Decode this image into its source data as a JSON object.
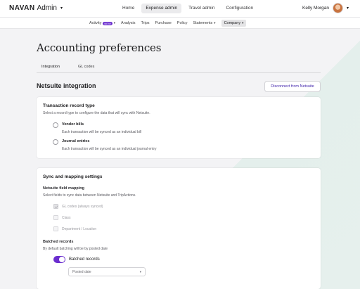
{
  "topbar": {
    "logo_mark": "NAVAN",
    "logo_text": "Admin",
    "nav": [
      {
        "label": "Home",
        "active": false
      },
      {
        "label": "Expense admin",
        "active": true
      },
      {
        "label": "Travel admin",
        "active": false
      },
      {
        "label": "Configuration",
        "active": false
      }
    ],
    "user_name": "Kelly Morgan"
  },
  "subnav": {
    "items": [
      {
        "label": "Activity",
        "badge": "NEW",
        "has_chevron": true
      },
      {
        "label": "Analysis"
      },
      {
        "label": "Trips"
      },
      {
        "label": "Purchase"
      },
      {
        "label": "Policy"
      },
      {
        "label": "Statements",
        "has_chevron": true
      },
      {
        "label": "Company",
        "has_chevron": true,
        "active": true
      }
    ]
  },
  "page": {
    "title": "Accounting preferences",
    "tabs": [
      {
        "label": "Integration",
        "active": true
      },
      {
        "label": "GL codes",
        "active": false
      }
    ],
    "section_title": "Netsuite integration",
    "disconnect_label": "Disconnect from Netsuite"
  },
  "transaction_card": {
    "heading": "Transaction record type",
    "subheading": "Select a record type to configure the data that will sync with Netsuite.",
    "options": [
      {
        "label": "Vendor bills",
        "desc": "Each transaction will be synced as an individual bill"
      },
      {
        "label": "Journal entries",
        "desc": "Each transaction will be synced as an individual journal entry"
      }
    ]
  },
  "sync_card": {
    "heading": "Sync and mapping settings",
    "field_mapping_title": "Netsuite field mapping",
    "field_mapping_sub": "Select fields to sync data between Netsuite and TripActions.",
    "fields": [
      {
        "label": "GL codes (always synced)",
        "checked": true
      },
      {
        "label": "Class",
        "checked": false
      },
      {
        "label": "Department / Location",
        "checked": false
      }
    ],
    "batched_title": "Batched records",
    "batched_sub": "By default batching will be by posted date",
    "toggle_label": "Batched records",
    "toggle_on": true,
    "select_value": "Posted date"
  },
  "colors": {
    "accent": "#6b2ecf",
    "link": "#3a1ca8",
    "background": "#f2f2f4",
    "teal_panel": "#e6f0ed"
  }
}
